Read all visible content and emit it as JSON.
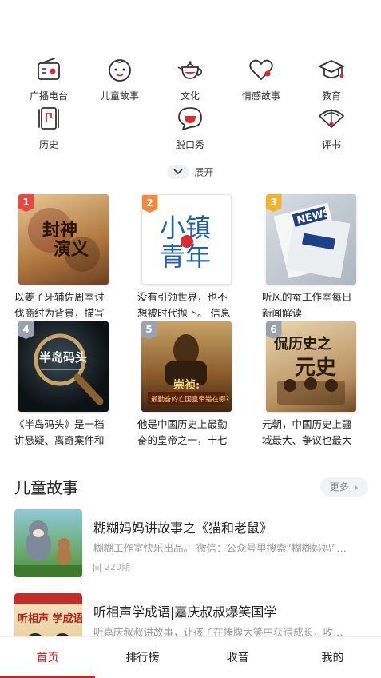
{
  "categories": [
    {
      "label": "广播电台",
      "icon": "radio-icon"
    },
    {
      "label": "儿童故事",
      "icon": "child-face-icon"
    },
    {
      "label": "文化",
      "icon": "teapot-icon"
    },
    {
      "label": "情感故事",
      "icon": "heart-icon"
    },
    {
      "label": "教育",
      "icon": "graduation-cap-icon"
    },
    {
      "label": "历史",
      "icon": "scroll-icon"
    },
    {
      "label": "脱口秀",
      "icon": "chat-bubble-icon"
    },
    {
      "label": "评书",
      "icon": "fan-icon"
    }
  ],
  "expand_label": "展开",
  "ranking": [
    {
      "rank": "1",
      "desc": "以姜子牙辅佐周室讨伐商纣为背景，描写",
      "cover_text": "封神演义",
      "badge_color": "#e84a3f"
    },
    {
      "rank": "2",
      "desc": "没有引领世界，也不想被时代抛下。 信息",
      "cover_text": "小镇青年",
      "badge_color": "#f08a3c"
    },
    {
      "rank": "3",
      "desc": "听风的蚕工作室每日新闻解读",
      "cover_text": "NEWS",
      "badge_color": "#f2b42e"
    },
    {
      "rank": "4",
      "desc": "《半岛码头》是一档讲悬疑、离奇案件和",
      "cover_text": "半岛码头",
      "badge_color": "#9aa3ad"
    },
    {
      "rank": "5",
      "desc": "他是中国历史上最勤奋的皇帝之一，十七",
      "cover_text": "崇祯：最勤奋的亡国皇帝错在哪?",
      "badge_color": "#9aa3ad"
    },
    {
      "rank": "6",
      "desc": "元朝，中国历史上疆域最大、争议也最大",
      "cover_text": "侃历史之元史",
      "badge_color": "#9aa3ad"
    }
  ],
  "section": {
    "title": "儿童故事",
    "more": "更多"
  },
  "stories": [
    {
      "title": "糊糊妈妈讲故事之《猫和老鼠》",
      "sub": "糊糊工作室快乐出品。 微信：公众号里搜索“糊糊妈妈”…",
      "count": "220期"
    },
    {
      "title": "听相声学成语|嘉庆叔叔爆笑国学",
      "sub": "听嘉庆叔叔讲故事，让孩子在捧腹大笑中获得成长，收…",
      "cover_text": "听相声 学成语"
    }
  ],
  "tabs": [
    {
      "label": "首页",
      "active": true
    },
    {
      "label": "排行榜",
      "active": false
    },
    {
      "label": "收音",
      "active": false
    },
    {
      "label": "我的",
      "active": false
    }
  ],
  "colors": {
    "accent": "#d9211b",
    "icon_stroke": "#333333",
    "icon_red": "#e0292e"
  }
}
